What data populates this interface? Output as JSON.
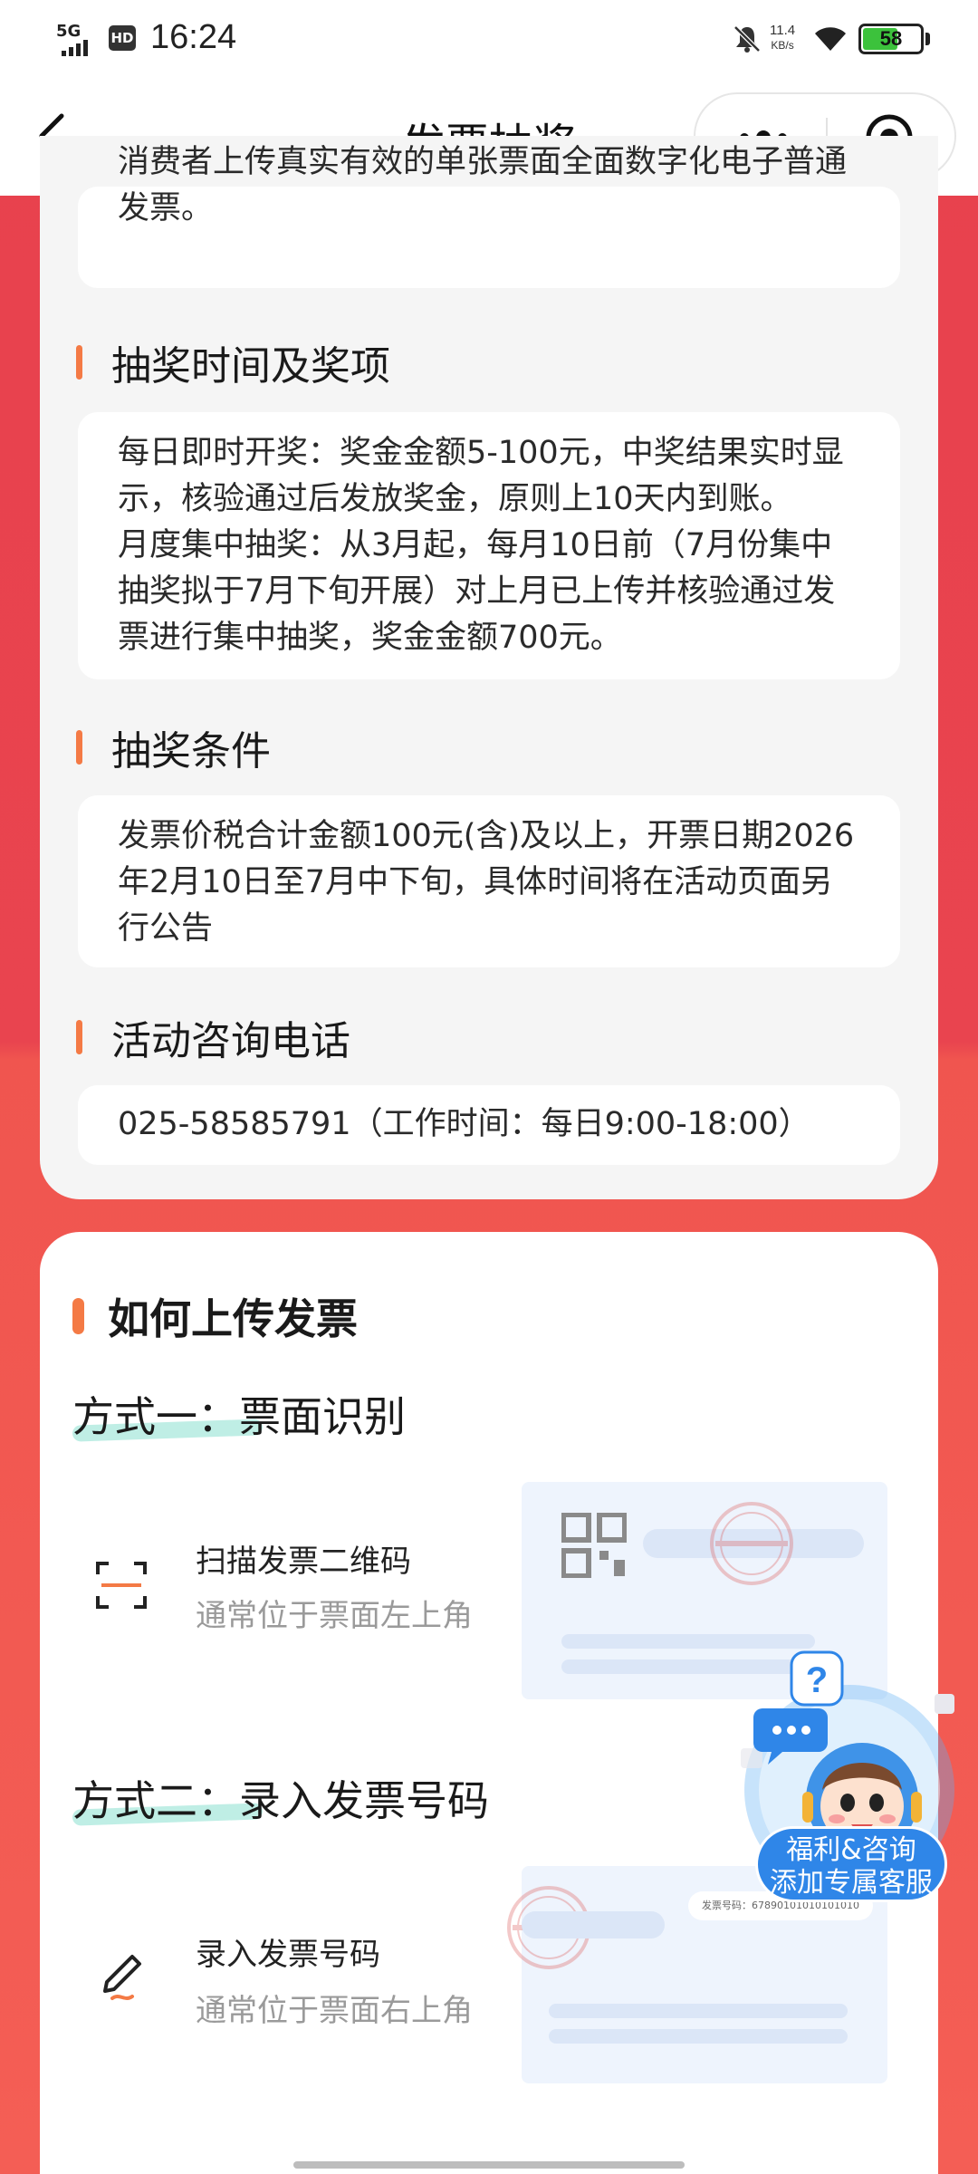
{
  "status_bar": {
    "network": "5G",
    "hd": "HD",
    "time": "16:24",
    "speed_value": "11.4",
    "speed_unit": "KB/s",
    "battery": "58"
  },
  "nav": {
    "title": "发票抽奖"
  },
  "intro": {
    "text": "消费者上传真实有效的单张票面全面数字化电子普通发票。"
  },
  "sections": [
    {
      "title": "抽奖时间及奖项",
      "paragraphs": [
        "每日即时开奖：奖金金额5-100元，中奖结果实时显示，核验通过后发放奖金，原则上10天内到账。",
        "月度集中抽奖：从3月起，每月10日前（7月份集中抽奖拟于7月下旬开展）对上月已上传并核验通过发票进行集中抽奖，奖金金额700元。"
      ]
    },
    {
      "title": "抽奖条件",
      "paragraphs": [
        "发票价税合计金额100元(含)及以上，开票日期2026年2月10日至7月中下旬，具体时间将在活动页面另行公告"
      ]
    },
    {
      "title": "活动咨询电话",
      "paragraphs": [
        "025-58585791（工作时间：每日9:00-18:00）"
      ]
    }
  ],
  "upload": {
    "title": "如何上传发票",
    "method1": {
      "title": "方式一：票面识别",
      "label": "扫描发票二维码",
      "sub": "通常位于票面左上角"
    },
    "method2": {
      "title": "方式二：录入发票号码",
      "label": "录入发票号码",
      "sub": "通常位于票面右上角",
      "sample": "发票号码：67890101010101010"
    }
  },
  "service": {
    "line1": "福利&咨询",
    "line2": "添加专属客服"
  },
  "colors": {
    "background_red": "#e8414d",
    "accent_orange": "#f47a45",
    "service_blue": "#2f86e8",
    "highlight_mint": "#b8ece2"
  }
}
